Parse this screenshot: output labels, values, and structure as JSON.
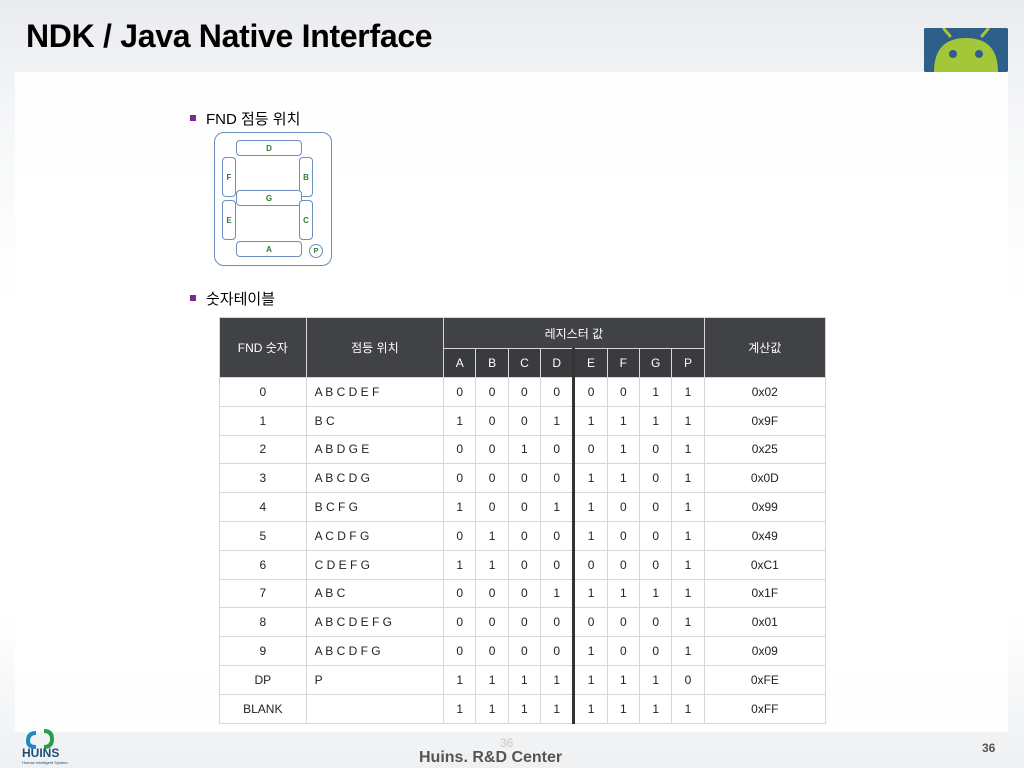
{
  "slide": {
    "title": "NDK / Java Native Interface",
    "footer_center": "Huins. R&D Center",
    "page_number": "36",
    "ghost_page_number": "36",
    "company_logo_text": "HUINS",
    "company_logo_subtext": "Human Intelligent System"
  },
  "bullets": [
    {
      "label": "FND 점등 위치"
    },
    {
      "label": "숫자테이블"
    }
  ],
  "fnd": {
    "segments": {
      "D": "D",
      "F": "F",
      "B": "B",
      "G": "G",
      "E": "E",
      "C": "C",
      "A": "A",
      "P": "P"
    }
  },
  "table": {
    "headers": {
      "fnd_num": "FND 숫자",
      "position": "점등 위치",
      "register": "레지스터 값",
      "calc": "계산값",
      "bits": [
        "A",
        "B",
        "C",
        "D",
        "E",
        "F",
        "G",
        "P"
      ]
    },
    "rows": [
      {
        "num": "0",
        "pos": "A B C D E F",
        "bits": [
          "0",
          "0",
          "0",
          "0",
          "0",
          "0",
          "1",
          "1"
        ],
        "val": "0x02"
      },
      {
        "num": "1",
        "pos": "B C",
        "bits": [
          "1",
          "0",
          "0",
          "1",
          "1",
          "1",
          "1",
          "1"
        ],
        "val": "0x9F"
      },
      {
        "num": "2",
        "pos": "A B D G E",
        "bits": [
          "0",
          "0",
          "1",
          "0",
          "0",
          "1",
          "0",
          "1"
        ],
        "val": "0x25"
      },
      {
        "num": "3",
        "pos": "A B C D G",
        "bits": [
          "0",
          "0",
          "0",
          "0",
          "1",
          "1",
          "0",
          "1"
        ],
        "val": "0x0D"
      },
      {
        "num": "4",
        "pos": "B C F G",
        "bits": [
          "1",
          "0",
          "0",
          "1",
          "1",
          "0",
          "0",
          "1"
        ],
        "val": "0x99"
      },
      {
        "num": "5",
        "pos": "A C D F G",
        "bits": [
          "0",
          "1",
          "0",
          "0",
          "1",
          "0",
          "0",
          "1"
        ],
        "val": "0x49"
      },
      {
        "num": "6",
        "pos": "C D E F G",
        "bits": [
          "1",
          "1",
          "0",
          "0",
          "0",
          "0",
          "0",
          "1"
        ],
        "val": "0xC1"
      },
      {
        "num": "7",
        "pos": "A B C",
        "bits": [
          "0",
          "0",
          "0",
          "1",
          "1",
          "1",
          "1",
          "1"
        ],
        "val": "0x1F"
      },
      {
        "num": "8",
        "pos": "A B C D E F G",
        "bits": [
          "0",
          "0",
          "0",
          "0",
          "0",
          "0",
          "0",
          "1"
        ],
        "val": "0x01"
      },
      {
        "num": "9",
        "pos": "A B C D F G",
        "bits": [
          "0",
          "0",
          "0",
          "0",
          "1",
          "0",
          "0",
          "1"
        ],
        "val": "0x09"
      },
      {
        "num": "DP",
        "pos": "P",
        "bits": [
          "1",
          "1",
          "1",
          "1",
          "1",
          "1",
          "1",
          "0"
        ],
        "val": "0xFE"
      },
      {
        "num": "BLANK",
        "pos": "",
        "bits": [
          "1",
          "1",
          "1",
          "1",
          "1",
          "1",
          "1",
          "1"
        ],
        "val": "0xFF"
      }
    ]
  },
  "colors": {
    "bullet": "#7a2a8e",
    "header_bg": "#404246",
    "fnd_outline": "#6a8fbe",
    "segment_label": "#2f7a3a",
    "android_green": "#a4c639"
  }
}
